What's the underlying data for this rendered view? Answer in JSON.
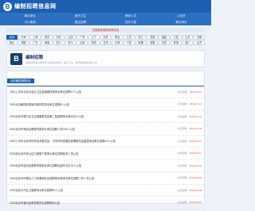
{
  "header": {
    "logo_glyph": "B",
    "title": "编制招聘信息网"
  },
  "nav": [
    "事业单位",
    "医疗卫生",
    "教师人员",
    "公务员",
    "中小教师",
    "国企招聘",
    "招才引智",
    "事业单位"
  ],
  "notice": "全国最新编制招聘信息",
  "regions": [
    {
      "label": "北京",
      "active": true
    },
    {
      "label": "天津"
    },
    {
      "label": "上海"
    },
    {
      "label": "重庆"
    },
    {
      "label": "河北"
    },
    {
      "label": "山西"
    },
    {
      "label": "广西"
    },
    {
      "label": "辽宁"
    },
    {
      "label": "吉林"
    },
    {
      "label": "黑龙"
    },
    {
      "label": "江苏"
    },
    {
      "label": "浙江"
    },
    {
      "label": "安徽"
    },
    {
      "label": "福建"
    },
    {
      "label": "江西"
    },
    {
      "label": "山东"
    },
    {
      "label": "河南"
    },
    {
      "label": "湖北"
    },
    {
      "label": "湖南"
    },
    {
      "label": "广东"
    },
    {
      "label": "海南"
    },
    {
      "label": "四川"
    },
    {
      "label": "贵州"
    },
    {
      "label": "云南"
    },
    {
      "label": "陕西"
    },
    {
      "label": "甘肃"
    },
    {
      "label": "青海"
    },
    {
      "label": "宁夏"
    },
    {
      "label": "新疆"
    },
    {
      "label": "西藏"
    },
    {
      "label": "内蒙"
    },
    {
      "label": "香港"
    },
    {
      "label": "澳门"
    },
    {
      "label": "台湾"
    }
  ],
  "brand": {
    "logo_glyph": "B",
    "name": "编制招聘",
    "desc": "编制招聘信息网收录全国事业单位、医疗卫生、教师等编制招聘公告"
  },
  "panel": {
    "tab_label": "北京编制招聘信息"
  },
  "articles": [
    {
      "title": "2023上半年北京丰台区卫生健康委所属事业单位招聘17人公告",
      "source": "北京招聘",
      "date": "2023-07-11"
    },
    {
      "title": "2023北京朝阳区委宣传部所属事业单位招聘6人公告",
      "source": "北京招聘",
      "date": "2023-07-11"
    },
    {
      "title": "2023北京市顺义区卫生健康委员会第二批招聘事业单位50人公告",
      "source": "北京招聘",
      "date": "2023-07-10"
    },
    {
      "title": "2023北京市海淀区教委所属事业单位招聘人员215人公告",
      "source": "北京招聘",
      "date": "2023-07-10"
    },
    {
      "title": "2023上半年北京市科学技术委员会、中关村科技园区管理委员会直属事业单位招聘44人公告",
      "source": "北京招聘",
      "date": "2023-07-07"
    },
    {
      "title": "2023年北京市房山区卫健委下属事业单位招聘医务人员公告",
      "source": "北京招聘",
      "date": "2023-07-07"
    },
    {
      "title": "2023北京市延庆区教委所属事业单位招聘应届毕业生32人公告",
      "source": "北京招聘",
      "date": "2023-07-06"
    },
    {
      "title": "2023北京市怀柔区人力资源和社会保障局所属事业单位招聘工作人员公告",
      "source": "北京招聘",
      "date": "2023-07-06"
    },
    {
      "title": "2023北京大兴区卫健委事业单位招聘30人公告",
      "source": "北京招聘",
      "date": "2023-07-05"
    },
    {
      "title": "2023北京市通州区教育委员会招聘教师公告",
      "source": "北京招聘",
      "date": "2023-07-05"
    }
  ]
}
